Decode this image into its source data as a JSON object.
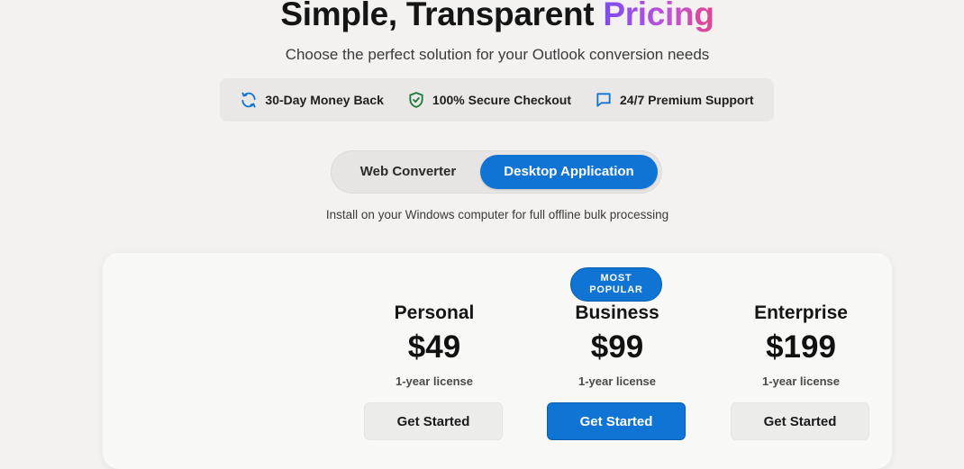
{
  "header": {
    "title_plain": "Simple, Transparent",
    "title_accent": "Pricing",
    "subtitle": "Choose the perfect solution for your Outlook conversion needs"
  },
  "features": [
    {
      "icon": "refresh-icon",
      "label": "30-Day Money Back"
    },
    {
      "icon": "shield-check-icon",
      "label": "100% Secure Checkout"
    },
    {
      "icon": "chat-icon",
      "label": "24/7 Premium Support"
    }
  ],
  "toggle": {
    "options": [
      "Web Converter",
      "Desktop Application"
    ],
    "selected": "Desktop Application",
    "caption": "Install on your Windows computer for full offline bulk processing"
  },
  "plans": [
    {
      "name": "Personal",
      "price": "$49",
      "license": "1-year license",
      "cta": "Get Started"
    },
    {
      "name": "Business",
      "price": "$99",
      "license": "1-year license",
      "cta": "Get Started",
      "badge_line1": "MOST",
      "badge_line2": "POPULAR"
    },
    {
      "name": "Enterprise",
      "price": "$199",
      "license": "1-year license",
      "cta": "Get Started"
    }
  ],
  "colors": {
    "primary": "#0f74d3",
    "accent_gradient_start": "#7b4cf0",
    "accent_gradient_end": "#e0468f",
    "shield_green": "#1f7a3a"
  }
}
